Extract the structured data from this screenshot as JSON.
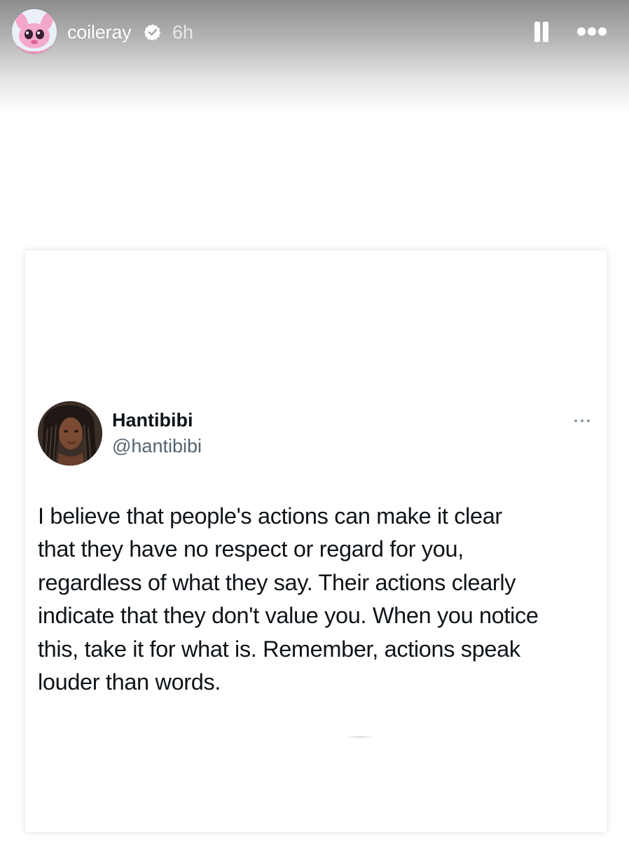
{
  "story": {
    "username": "coileray",
    "timestamp": "6h",
    "icons": {
      "avatar": "profile-avatar-cartoon",
      "verified": "verified-badge-icon",
      "pause": "pause-icon",
      "more": "more-options-icon"
    }
  },
  "tweet": {
    "display_name": "Hantibibi",
    "handle": "@hantibibi",
    "text_lines": [
      "I believe that people's actions can make it clear",
      "that they have no respect or regard for you,",
      "regardless of what they say. Their actions clearly",
      "indicate that they don't value you. When you notice",
      "this, take it for what is. Remember, actions speak",
      "louder than words."
    ],
    "icons": {
      "avatar": "profile-photo",
      "more": "more-options-icon"
    }
  },
  "colors": {
    "text_primary": "#0f1419",
    "text_secondary": "#536471",
    "header_text": "#ffffff"
  }
}
